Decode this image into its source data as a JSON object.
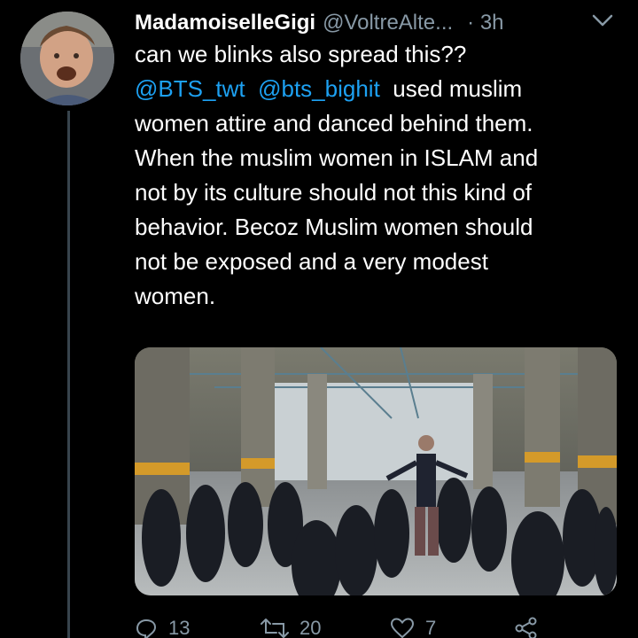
{
  "tweet": {
    "display_name": "MadamoiselleGigi",
    "handle": "@VoltreAlte...",
    "time": "· 3h",
    "lines": [
      "can we blinks also spread this??",
      "used muslim",
      "women attire and danced behind them.",
      "When the muslim women in ISLAM and",
      "not by its culture should not this kind of",
      "behavior. Becoz Muslim women should",
      "not be exposed and a very modest",
      "women."
    ],
    "mentions": [
      "@BTS_twt",
      "@bts_bighit"
    ]
  },
  "actions": {
    "replies": "13",
    "retweets": "20",
    "likes": "7"
  },
  "colors": {
    "background": "#000000",
    "text": "#ffffff",
    "secondary": "#8899a6",
    "link": "#1da1f2"
  },
  "icons": [
    "avatar",
    "chevron-down-icon",
    "reply-icon",
    "retweet-icon",
    "like-icon",
    "share-icon"
  ]
}
